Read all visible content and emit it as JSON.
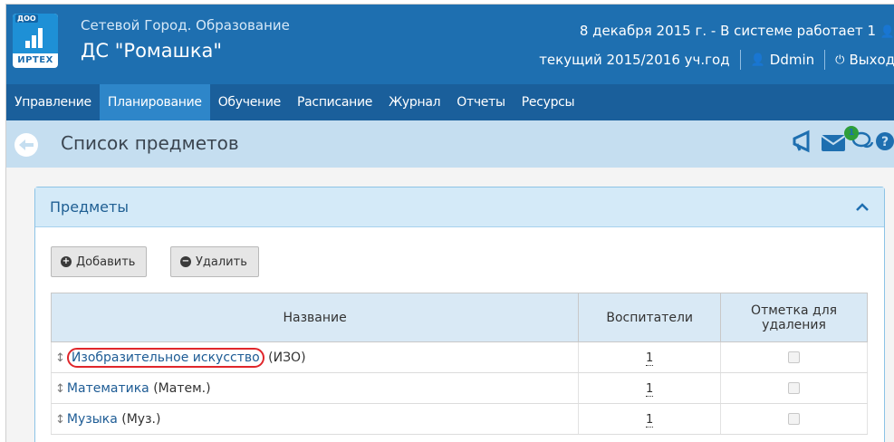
{
  "header": {
    "logo_badge": "ДОО",
    "logo_brand": "ИРТЕХ",
    "system_name": "Сетевой Город. Образование",
    "org_name": "ДС \"Ромашка\"",
    "date_line": "8 декабря 2015 г. - В системе работает 1",
    "school_year": "текущий 2015/2016 уч.год",
    "user_name": "Ddmin",
    "logout_label": "Выход"
  },
  "nav": {
    "items": [
      "Управление",
      "Планирование",
      "Обучение",
      "Расписание",
      "Журнал",
      "Отчеты",
      "Ресурсы"
    ],
    "active_index": 1
  },
  "titlebar": {
    "title": "Список предметов",
    "messages_badge": "1"
  },
  "panel": {
    "title": "Предметы",
    "add_label": "Добавить",
    "delete_label": "Удалить",
    "columns": [
      "Название",
      "Воспитатели",
      "Отметка для удаления"
    ],
    "rows": [
      {
        "name": "Изобразительное искусство",
        "abbr": "(ИЗО)",
        "teachers": "1",
        "highlighted": true
      },
      {
        "name": "Математика",
        "abbr": "(Матем.)",
        "teachers": "1",
        "highlighted": false
      },
      {
        "name": "Музыка",
        "abbr": "(Муз.)",
        "teachers": "1",
        "highlighted": false
      }
    ]
  },
  "colors": {
    "header_bg": "#1e6fb0",
    "nav_bg": "#1a5f9b",
    "nav_active_bg": "#2e86c9",
    "titlebar_bg": "#c5def0",
    "panel_head_bg": "#d4eaf8",
    "link": "#1e5c95",
    "highlight_ring": "#e0262b"
  },
  "icons": [
    "back-arrow-icon",
    "megaphone-icon",
    "envelope-icon",
    "chat-icon",
    "help-icon",
    "user-icon",
    "power-icon",
    "chevron-up-icon",
    "plus-circle-icon",
    "minus-circle-icon",
    "drag-handle-icon"
  ]
}
